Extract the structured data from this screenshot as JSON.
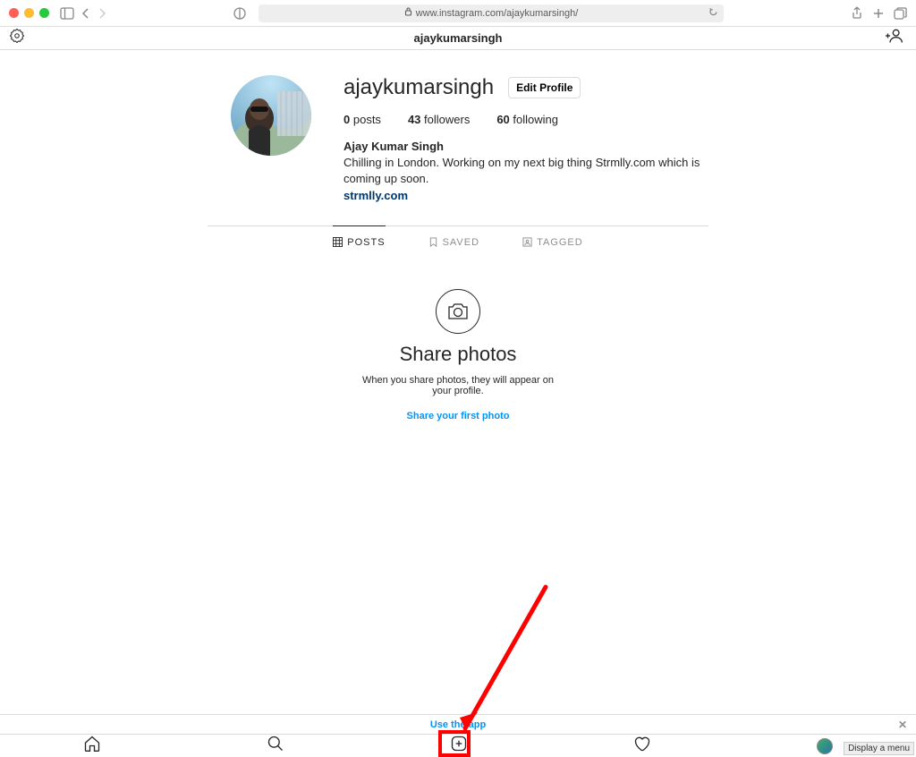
{
  "browser": {
    "url": "www.instagram.com/ajaykumarsingh/"
  },
  "header": {
    "title": "ajaykumarsingh"
  },
  "profile": {
    "username": "ajaykumarsingh",
    "edit_label": "Edit Profile",
    "stats": {
      "posts_count": "0",
      "posts_label": "posts",
      "followers_count": "43",
      "followers_label": "followers",
      "following_count": "60",
      "following_label": "following"
    },
    "display_name": "Ajay Kumar Singh",
    "bio": "Chilling in London. Working on my next big thing Strmlly.com which is coming up soon.",
    "link": "strmlly.com"
  },
  "tabs": {
    "posts": "POSTS",
    "saved": "SAVED",
    "tagged": "TAGGED"
  },
  "empty": {
    "title": "Share photos",
    "text": "When you share photos, they will appear on your profile.",
    "cta": "Share your first photo"
  },
  "banner": {
    "label": "Use the app"
  },
  "tooltip": "Display a menu"
}
